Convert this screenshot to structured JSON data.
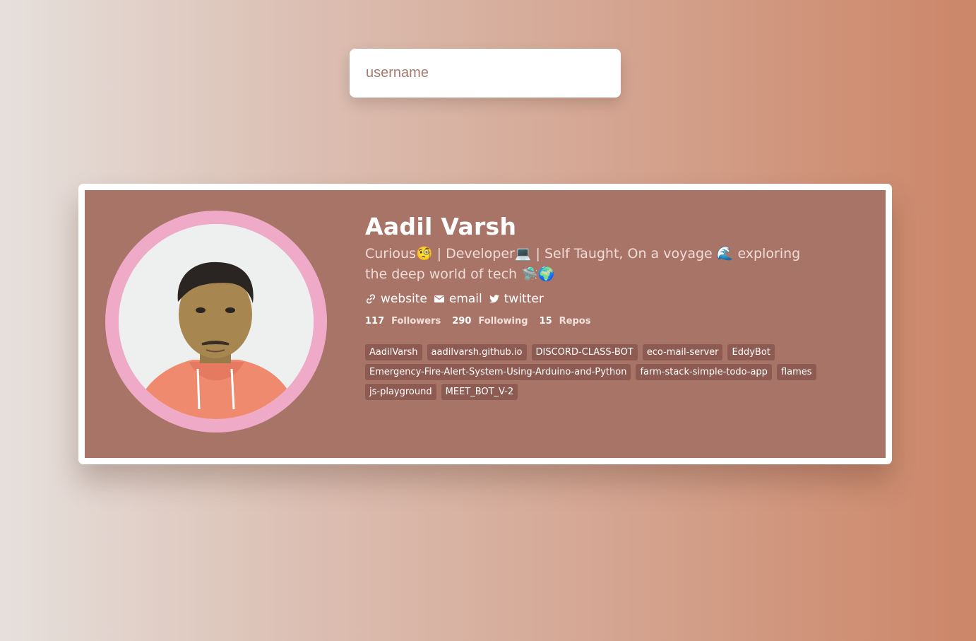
{
  "search": {
    "placeholder": "username",
    "value": ""
  },
  "profile": {
    "name": "Aadil Varsh",
    "bio": "Curious🧐 | Developer💻 | Self Taught, On a voyage 🌊 exploring the deep world of tech 🛸🌍",
    "links": [
      {
        "label": "website",
        "icon": "link-icon"
      },
      {
        "label": "email",
        "icon": "envelope-icon"
      },
      {
        "label": "twitter",
        "icon": "twitter-icon"
      }
    ],
    "stats": {
      "followers_count": "117",
      "followers_label": "Followers",
      "following_count": "290",
      "following_label": "Following",
      "repos_count": "15",
      "repos_label": "Repos"
    },
    "repos": [
      "AadilVarsh",
      "aadilvarsh.github.io",
      "DISCORD-CLASS-BOT",
      "eco-mail-server",
      "EddyBot",
      "Emergency-Fire-Alert-System-Using-Arduino-and-Python",
      "farm-stack-simple-todo-app",
      "flames",
      "js-playground",
      "MEET_BOT_V-2"
    ]
  },
  "colors": {
    "card_background": "#a87468",
    "avatar_ring": "#eeaac6",
    "repo_chip": "#8e5b52"
  }
}
